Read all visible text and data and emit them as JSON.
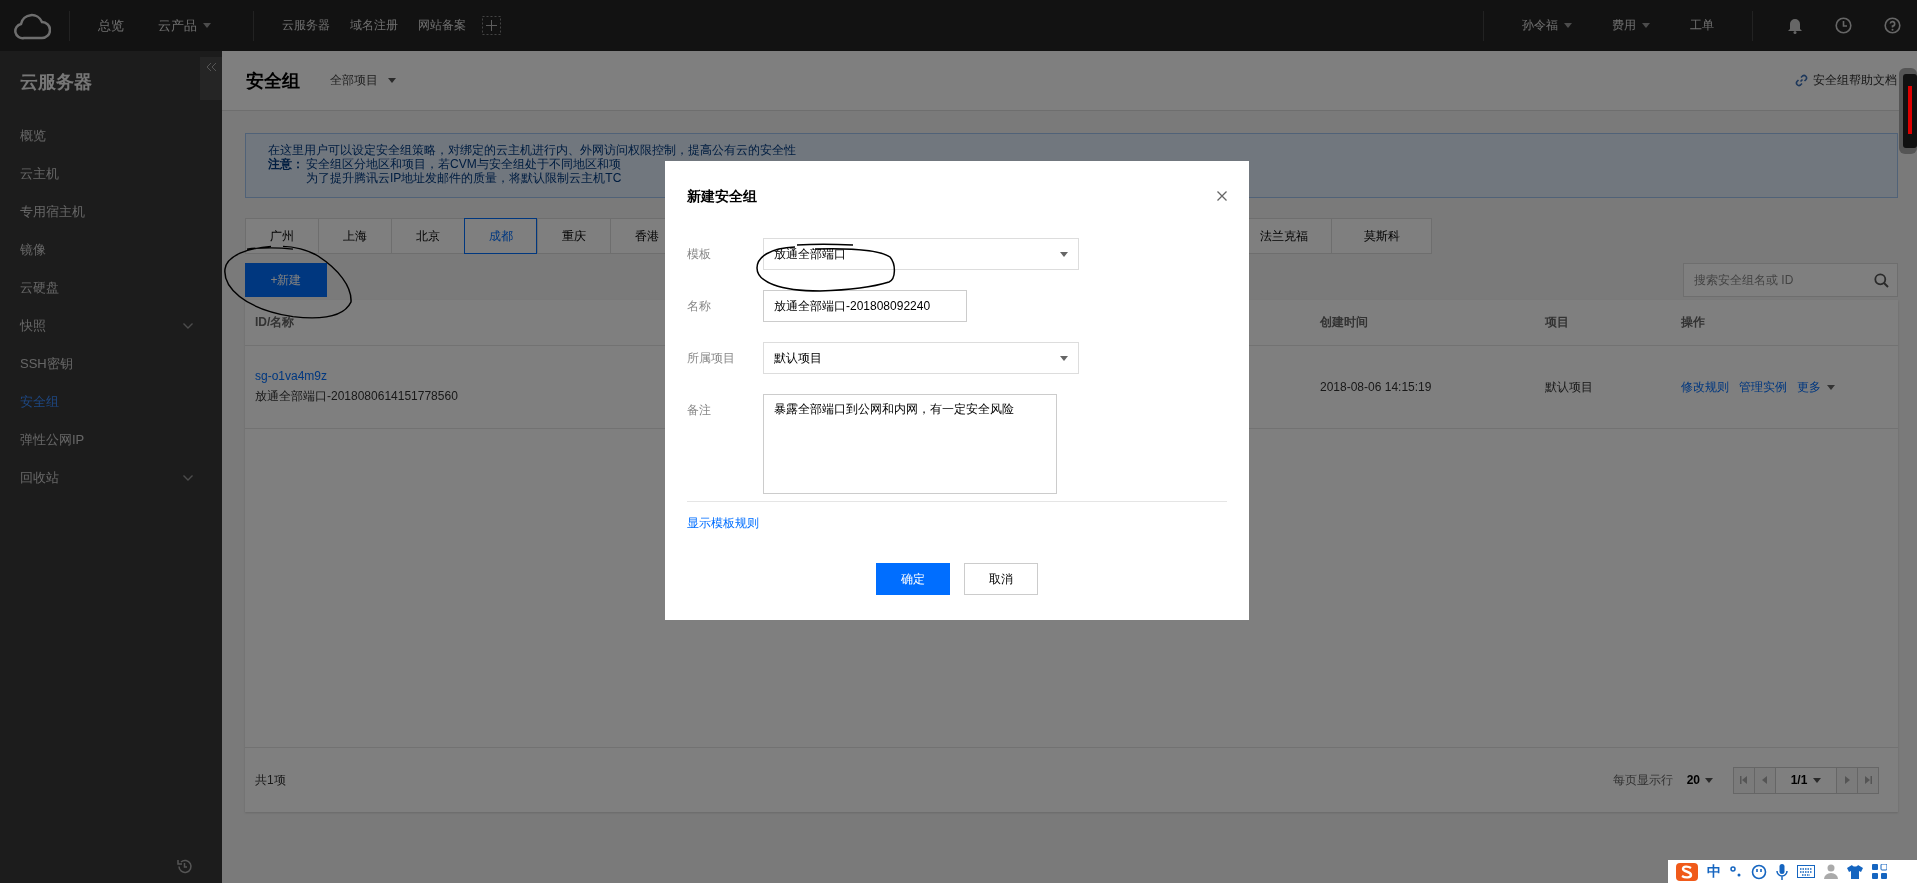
{
  "topbar": {
    "nav": [
      {
        "label": "总览",
        "dropdown": false
      },
      {
        "label": "云产品",
        "dropdown": true
      }
    ],
    "shortcuts": [
      "云服务器",
      "域名注册",
      "网站备案"
    ],
    "user_menu": [
      {
        "label": "孙令福",
        "dropdown": true
      },
      {
        "label": "费用",
        "dropdown": true
      },
      {
        "label": "工单",
        "dropdown": false
      }
    ]
  },
  "sidebar": {
    "title": "云服务器",
    "items": [
      {
        "label": "概览",
        "selected": false,
        "expandable": false
      },
      {
        "label": "云主机",
        "selected": false,
        "expandable": false
      },
      {
        "label": "专用宿主机",
        "selected": false,
        "expandable": false
      },
      {
        "label": "镜像",
        "selected": false,
        "expandable": false
      },
      {
        "label": "云硬盘",
        "selected": false,
        "expandable": false
      },
      {
        "label": "快照",
        "selected": false,
        "expandable": true
      },
      {
        "label": "SSH密钥",
        "selected": false,
        "expandable": false
      },
      {
        "label": "安全组",
        "selected": true,
        "expandable": false
      },
      {
        "label": "弹性公网IP",
        "selected": false,
        "expandable": false
      },
      {
        "label": "回收站",
        "selected": false,
        "expandable": true
      }
    ]
  },
  "header": {
    "title": "安全组",
    "project_filter": "全部项目",
    "help_link": "安全组帮助文档"
  },
  "notice": {
    "intro": "在这里用户可以设定安全组策略，对绑定的云主机进行内、外网访问权限控制，提高公有云的安全性",
    "note_label": "注意：",
    "notes": [
      "安全组区分地区和项目，若CVM与安全组处于不同地区和项",
      "为了提升腾讯云IP地址发邮件的质量，将默认限制云主机TC"
    ]
  },
  "region_tabs": [
    {
      "label": "广州",
      "selected": false
    },
    {
      "label": "上海",
      "selected": false
    },
    {
      "label": "北京",
      "selected": false
    },
    {
      "label": "成都",
      "selected": true
    },
    {
      "label": "重庆",
      "selected": false
    },
    {
      "label": "香港",
      "selected": false
    },
    {
      "label": "法兰克福",
      "selected": false
    },
    {
      "label": "莫斯科",
      "selected": false
    }
  ],
  "toolbar": {
    "new_button": "+新建",
    "search_placeholder": "搜索安全组名或 ID"
  },
  "table": {
    "columns": [
      "ID/名称",
      "创建时间",
      "项目",
      "操作"
    ],
    "rows": [
      {
        "id": "sg-o1va4m9z",
        "name": "放通全部端口-2018080614151778560",
        "created": "2018-08-06 14:15:19",
        "project": "默认项目",
        "actions": [
          {
            "label": "修改规则",
            "dropdown": false
          },
          {
            "label": "管理实例",
            "dropdown": false
          },
          {
            "label": "更多",
            "dropdown": true
          }
        ]
      }
    ]
  },
  "footer": {
    "total": "共1项",
    "page_size_label": "每页显示行",
    "page_size": "20",
    "page": "1/1"
  },
  "dialog": {
    "title": "新建安全组",
    "fields": [
      {
        "kind": "select",
        "label": "模板",
        "value": "放通全部端口"
      },
      {
        "kind": "input",
        "label": "名称",
        "value": "放通全部端口-201808092240"
      },
      {
        "kind": "select",
        "label": "所属项目",
        "value": "默认项目"
      },
      {
        "kind": "textarea",
        "label": "备注",
        "value": "暴露全部端口到公网和内网，有一定安全风险"
      }
    ],
    "link": "显示模板规则",
    "buttons": [
      {
        "label": "确定",
        "primary": true
      },
      {
        "label": "取消",
        "primary": false
      }
    ]
  },
  "ime": {
    "mode": "中"
  }
}
